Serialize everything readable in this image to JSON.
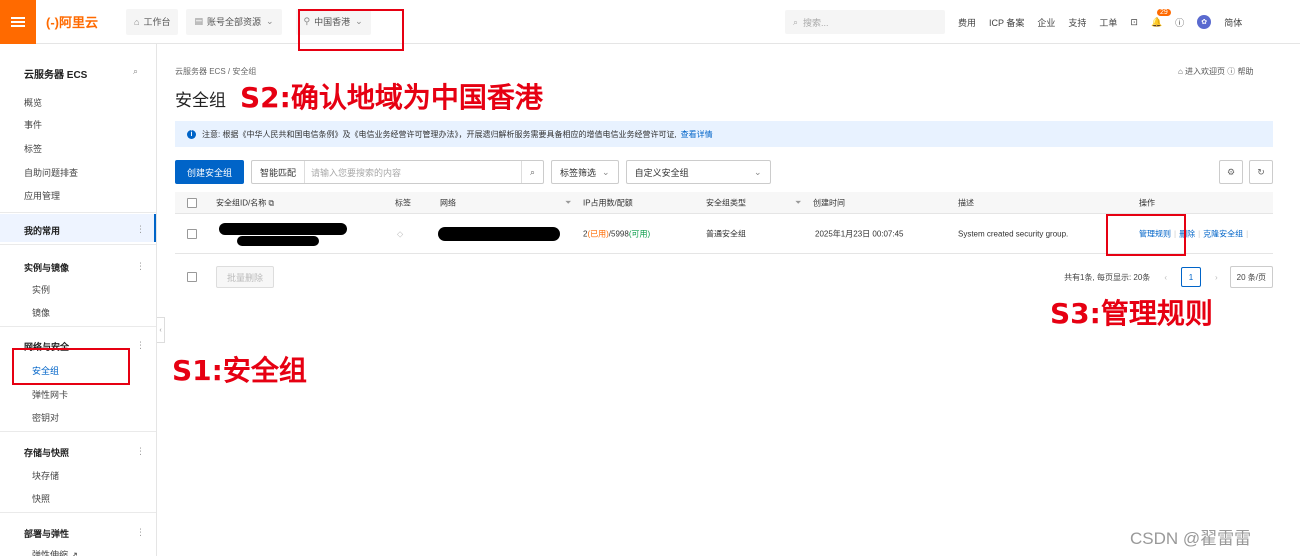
{
  "topbar": {
    "logo": "(-)阿里云",
    "workbench": "工作台",
    "account_resources": "账号全部资源",
    "region": "中国香港",
    "search_placeholder": "搜索...",
    "links": [
      "费用",
      "ICP 备案",
      "企业",
      "支持",
      "工单"
    ],
    "notification_count": "29",
    "lang": "简体"
  },
  "sidebar": {
    "title": "云服务器 ECS",
    "items_top": [
      "概览",
      "事件",
      "标签",
      "自助问题排查",
      "应用管理"
    ],
    "my_common": "我的常用",
    "group_instances": "实例与镜像",
    "instances_items": [
      "实例",
      "镜像"
    ],
    "group_network": "网络与安全",
    "network_items": [
      "安全组",
      "弹性网卡",
      "密钥对"
    ],
    "group_storage": "存储与快照",
    "storage_items": [
      "块存储",
      "快照"
    ],
    "group_deploy": "部署与弹性",
    "deploy_items": [
      "弹性伸缩 ↗"
    ]
  },
  "main": {
    "breadcrumb": "云服务器 ECS  /  安全组",
    "title": "安全组",
    "top_right": "⌂ 进入欢迎页  ⓘ 帮助",
    "notice_text": "注意: 根据《中华人民共和国电信条例》及《电信业务经营许可管理办法》，开展遗归解析服务需要具备相应的增值电信业务经营许可证,",
    "notice_link": "查看详情",
    "create_button": "创建安全组",
    "search_mode": "智能匹配",
    "search_placeholder": "请输入您要搜索的内容",
    "tag_filter": "标签筛选",
    "custom_group": "自定义安全组",
    "columns": {
      "id_name": "安全组ID/名称",
      "tag": "标签",
      "network": "网络",
      "ip": "IP占用数/配额",
      "type": "安全组类型",
      "created": "创建时间",
      "desc": "描述",
      "ops": "操作"
    },
    "row": {
      "ip_used": "2",
      "ip_used_label": "(已用)",
      "ip_quota": "/5998",
      "ip_avail_label": "(可用)",
      "type": "普通安全组",
      "created": "2025年1月23日 00:07:45",
      "desc": "System created security group.",
      "op_manage": "管理规则",
      "op_delete": "删除",
      "op_clone": "克隆安全组"
    },
    "bulk_delete": "批量删除",
    "pager_text": "共有1条, 每页显示: 20条",
    "page": "1",
    "page_size": "20 条/页"
  },
  "annotations": {
    "s1": "S1:安全组",
    "s2": "S2:确认地域为中国香港",
    "s3": "S3:管理规则"
  },
  "watermark": "CSDN @翟雷雷",
  "colors": {
    "accent": "#ff6a00",
    "primary": "#0064c8",
    "annotation": "#e60012"
  }
}
